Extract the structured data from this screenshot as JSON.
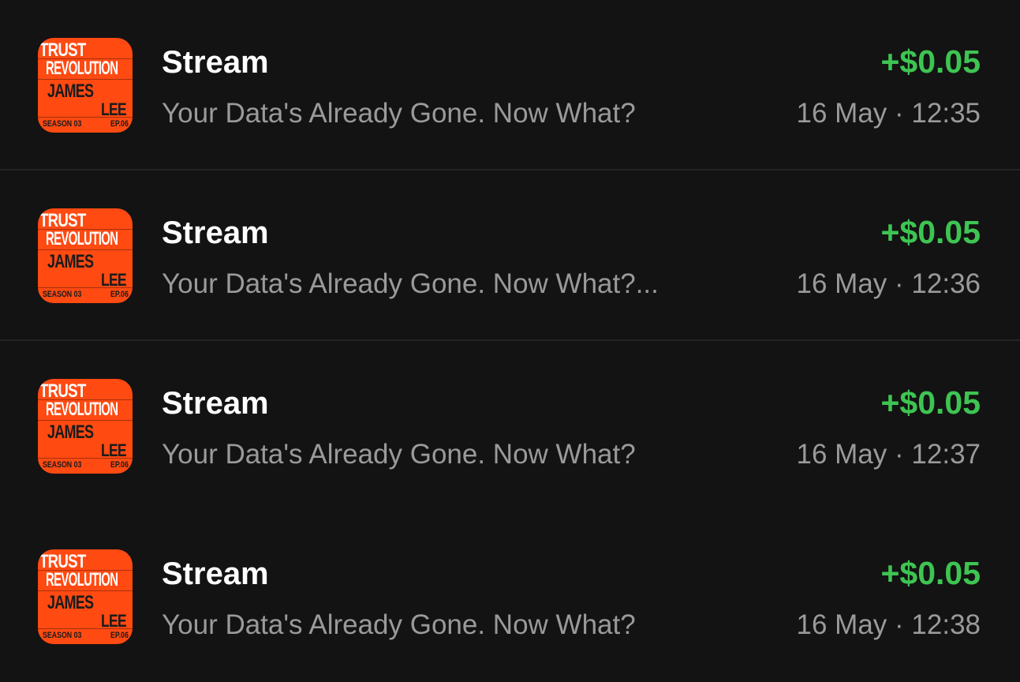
{
  "colors": {
    "background": "#131313",
    "title": "#ffffff",
    "secondary": "#9a9a9a",
    "amount_positive": "#3ec452",
    "thumbnail": "#ff4a12"
  },
  "thumbnail": {
    "line1": "TRUST",
    "line2": "REVOLUTION",
    "line3": "JAMES",
    "line4": "LEE",
    "season": "SEASON 03",
    "episode": "EP.06"
  },
  "transactions": [
    {
      "title": "Stream",
      "subtitle": "Your Data's Already Gone. Now What?",
      "amount": "+$0.05",
      "datetime": "16 May · 12:35"
    },
    {
      "title": "Stream",
      "subtitle": "Your Data's Already Gone. Now What?...",
      "amount": "+$0.05",
      "datetime": "16 May · 12:36"
    },
    {
      "title": "Stream",
      "subtitle": "Your Data's Already Gone. Now What?",
      "amount": "+$0.05",
      "datetime": "16 May · 12:37"
    },
    {
      "title": "Stream",
      "subtitle": "Your Data's Already Gone. Now What?",
      "amount": "+$0.05",
      "datetime": "16 May · 12:38"
    }
  ]
}
